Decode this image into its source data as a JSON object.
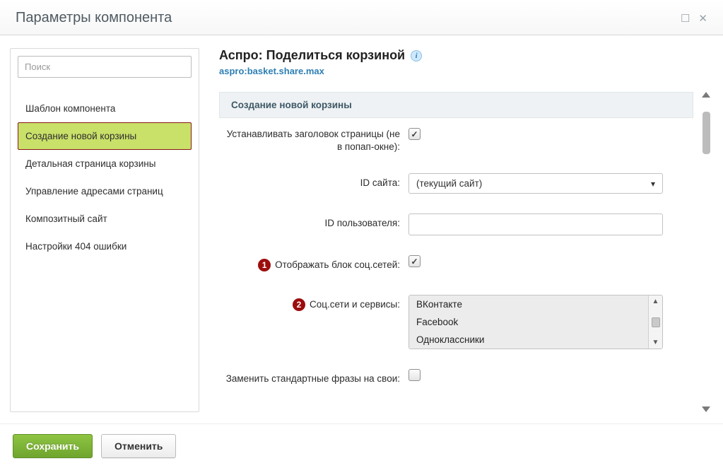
{
  "dialog": {
    "title": "Параметры компонента"
  },
  "search": {
    "placeholder": "Поиск"
  },
  "sidebar": {
    "items": [
      {
        "label": "Шаблон компонента"
      },
      {
        "label": "Создание новой корзины"
      },
      {
        "label": "Детальная страница корзины"
      },
      {
        "label": "Управление адресами страниц"
      },
      {
        "label": "Композитный сайт"
      },
      {
        "label": "Настройки 404 ошибки"
      }
    ],
    "active_index": 1
  },
  "component": {
    "title": "Аспро: Поделиться корзиной",
    "code": "aspro:basket.share.max"
  },
  "section": {
    "title": "Создание новой корзины"
  },
  "form": {
    "set_title": {
      "label": "Устанавливать заголовок страницы (не в попап-окне):",
      "checked": true
    },
    "site_id": {
      "label": "ID сайта:",
      "value": "(текущий сайт)"
    },
    "user_id": {
      "label": "ID пользователя:",
      "value": ""
    },
    "show_social": {
      "label": "Отображать блок соц.сетей:",
      "checked": true,
      "badge": "1"
    },
    "socials": {
      "label": "Соц.сети и сервисы:",
      "badge": "2",
      "options": [
        "ВКонтакте",
        "Facebook",
        "Одноклассники"
      ]
    },
    "replace_phrases": {
      "label": "Заменить стандартные фразы на свои:",
      "checked": false
    }
  },
  "footer": {
    "save": "Сохранить",
    "cancel": "Отменить"
  }
}
